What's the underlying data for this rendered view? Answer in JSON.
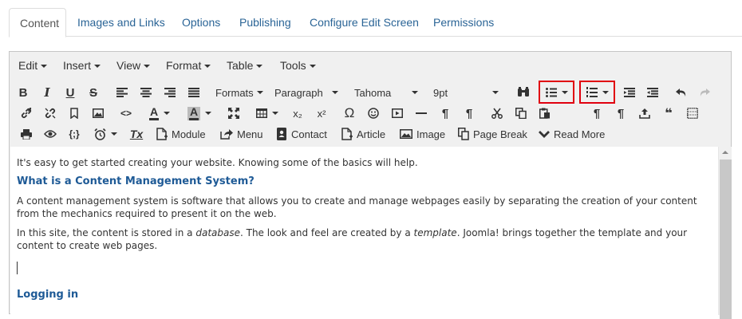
{
  "tabs": [
    {
      "label": "Content",
      "active": true
    },
    {
      "label": "Images and Links"
    },
    {
      "label": "Options"
    },
    {
      "label": "Publishing"
    },
    {
      "label": "Configure Edit Screen"
    },
    {
      "label": "Permissions"
    }
  ],
  "menubar": {
    "edit": "Edit",
    "insert": "Insert",
    "view": "View",
    "format": "Format",
    "table": "Table",
    "tools": "Tools"
  },
  "toolbar": {
    "formats": "Formats",
    "block_format": "Paragraph",
    "font_family": "Tahoma",
    "font_size": "9pt",
    "module": "Module",
    "menu": "Menu",
    "contact": "Contact",
    "article": "Article",
    "image": "Image",
    "page_break": "Page Break",
    "read_more": "Read More",
    "bold_glyph": "B",
    "italic_glyph": "I",
    "underline_glyph": "U",
    "strike_glyph": "S",
    "code_glyph": "<>",
    "sub_glyph": "x₂",
    "sup_glyph": "x²",
    "omega_glyph": "Ω",
    "pilcrow_glyph": "¶",
    "quote_glyph": "❝",
    "code_sample_glyph": "{;}",
    "clear_format_glyph": "Tx"
  },
  "content": {
    "p1": "It's easy to get started creating your website. Knowing some of the basics will help.",
    "h1": "What is a Content Management System?",
    "p2": "A content management system is software that allows you to create and manage webpages easily by separating the creation of your content from the mechanics required to present it on the web.",
    "p3_a": "In this site, the content is stored in a ",
    "p3_em1": "database",
    "p3_b": ". The look and feel are created by a ",
    "p3_em2": "template",
    "p3_c": ". Joomla! brings together the template and your content to create web pages.",
    "h2": "Logging in"
  },
  "colors": {
    "link_blue": "#2a6496",
    "heading_blue": "#1e5a96",
    "highlight_red": "#e0000f",
    "toolbar_bg": "#f0f0f0"
  }
}
